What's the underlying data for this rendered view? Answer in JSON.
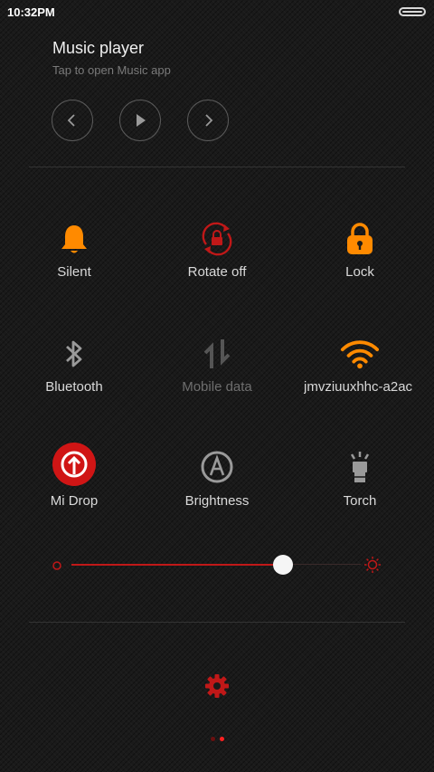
{
  "status_bar": {
    "time": "10:32PM"
  },
  "music_player": {
    "title": "Music player",
    "subtitle": "Tap to open Music app",
    "controls": [
      "previous-icon",
      "play-icon",
      "next-icon"
    ]
  },
  "toggles": [
    {
      "label": "Silent",
      "icon": "bell-icon",
      "state": "on",
      "color": "#ff8a00"
    },
    {
      "label": "Rotate off",
      "icon": "rotate-lock-icon",
      "state": "on",
      "color": "#c01818"
    },
    {
      "label": "Lock",
      "icon": "lock-icon",
      "state": "on",
      "color": "#ff8a00"
    },
    {
      "label": "Bluetooth",
      "icon": "bluetooth-icon",
      "state": "off",
      "color": "#9a9a9a"
    },
    {
      "label": "Mobile data",
      "icon": "mobile-data-icon",
      "state": "disabled",
      "color": "#555555"
    },
    {
      "label": "jmvziuuxhhc-a2ac",
      "icon": "wifi-icon",
      "state": "on",
      "color": "#ff8a00"
    },
    {
      "label": "Mi Drop",
      "icon": "mi-drop-icon",
      "state": "on",
      "color": "#d01515"
    },
    {
      "label": "Brightness",
      "icon": "auto-brightness-icon",
      "state": "off",
      "color": "#9a9a9a"
    },
    {
      "label": "Torch",
      "icon": "torch-icon",
      "state": "off",
      "color": "#9a9a9a"
    }
  ],
  "brightness": {
    "level_percent": 73,
    "accent": "#c01818"
  },
  "footer": {
    "settings_icon": "settings-gear-icon",
    "page_indicator": {
      "pages": 2,
      "current": 2
    }
  }
}
